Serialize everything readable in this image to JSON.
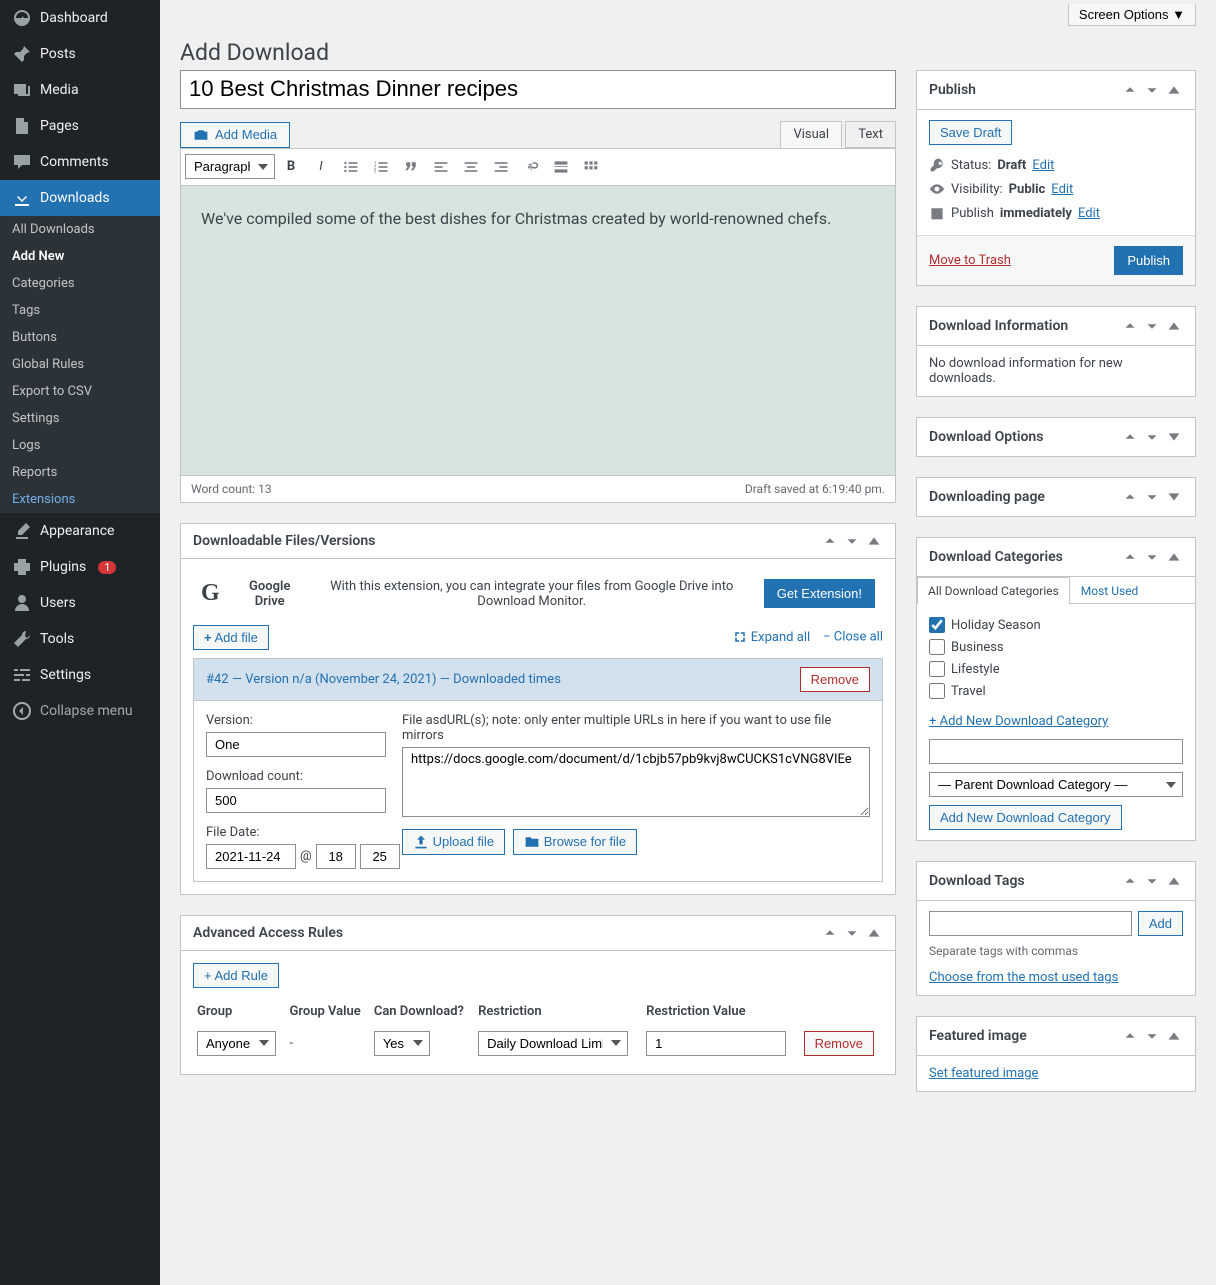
{
  "screenOptions": "Screen Options ▼",
  "pageTitle": "Add Download",
  "sidebar": {
    "dashboard": "Dashboard",
    "posts": "Posts",
    "media": "Media",
    "pages": "Pages",
    "comments": "Comments",
    "downloads": "Downloads",
    "appearance": "Appearance",
    "plugins": "Plugins",
    "pluginsBadge": "1",
    "users": "Users",
    "tools": "Tools",
    "settings": "Settings",
    "collapse": "Collapse menu",
    "sub": {
      "allDownloads": "All Downloads",
      "addNew": "Add New",
      "categories": "Categories",
      "tags": "Tags",
      "buttons": "Buttons",
      "globalRules": "Global Rules",
      "exportCsv": "Export to CSV",
      "settings": "Settings",
      "logs": "Logs",
      "reports": "Reports",
      "extensions": "Extensions"
    }
  },
  "titleInput": "10 Best Christmas Dinner recipes",
  "addMedia": "Add Media",
  "tabs": {
    "visual": "Visual",
    "text": "Text"
  },
  "toolbar": {
    "format": "Paragraph"
  },
  "editorBody": "We've compiled some of the best dishes for Christmas created by world-renowned chefs.",
  "wordCount": "Word count: 13",
  "draftSaved": "Draft saved at 6:19:40 pm.",
  "filesBox": {
    "title": "Downloadable Files/Versions",
    "gdriveTitle": "Google Drive",
    "gdriveDesc": "With this extension, you can integrate your files from Google Drive into Download Monitor.",
    "getExtension": "Get Extension!",
    "addFile": "Add file",
    "expandAll": "Expand all",
    "closeAll": "Close all",
    "versionHeader": "#42 — Version n/a (November 24, 2021) — Downloaded times",
    "remove": "Remove",
    "versionLabel": "Version:",
    "versionValue": "One",
    "dlCountLabel": "Download count:",
    "dlCountValue": "500",
    "fileDateLabel": "File Date:",
    "fileDate": "2021-11-24",
    "fileHour": "18",
    "fileMin": "25",
    "at": "@",
    "urlLabel": "File asdURL(s); note: only enter multiple URLs in here if you want to use file mirrors",
    "urlValue": "https://docs.google.com/document/d/1cbjb57pb9kvj8wCUCKS1cVNG8VIEe",
    "uploadFile": "Upload file",
    "browseFile": "Browse for file"
  },
  "rulesBox": {
    "title": "Advanced Access Rules",
    "addRule": "Add Rule",
    "headers": {
      "group": "Group",
      "groupValue": "Group Value",
      "canDl": "Can Download?",
      "restriction": "Restriction",
      "restrictionVal": "Restriction Value"
    },
    "row": {
      "group": "Anyone",
      "groupValue": "-",
      "canDl": "Yes",
      "restriction": "Daily Download Limit",
      "restrictionVal": "1",
      "remove": "Remove"
    }
  },
  "publish": {
    "title": "Publish",
    "saveDraft": "Save Draft",
    "statusLabel": "Status:",
    "statusVal": "Draft",
    "visibilityLabel": "Visibility:",
    "visibilityVal": "Public",
    "publishLabel": "Publish",
    "publishVal": "immediately",
    "edit": "Edit",
    "trash": "Move to Trash",
    "publishBtn": "Publish"
  },
  "dlInfo": {
    "title": "Download Information",
    "text": "No download information for new downloads."
  },
  "dlOptions": {
    "title": "Download Options"
  },
  "dlPage": {
    "title": "Downloading page"
  },
  "categories": {
    "title": "Download Categories",
    "tabAll": "All Download Categories",
    "tabMost": "Most Used",
    "items": [
      {
        "label": "Holiday Season",
        "checked": true
      },
      {
        "label": "Business",
        "checked": false
      },
      {
        "label": "Lifestyle",
        "checked": false
      },
      {
        "label": "Travel",
        "checked": false
      }
    ],
    "addNewLink": "+ Add New Download Category",
    "parentSelect": "— Parent Download Category —",
    "addNewBtn": "Add New Download Category"
  },
  "tags": {
    "title": "Download Tags",
    "add": "Add",
    "help": "Separate tags with commas",
    "choose": "Choose from the most used tags"
  },
  "featured": {
    "title": "Featured image",
    "link": "Set featured image"
  }
}
